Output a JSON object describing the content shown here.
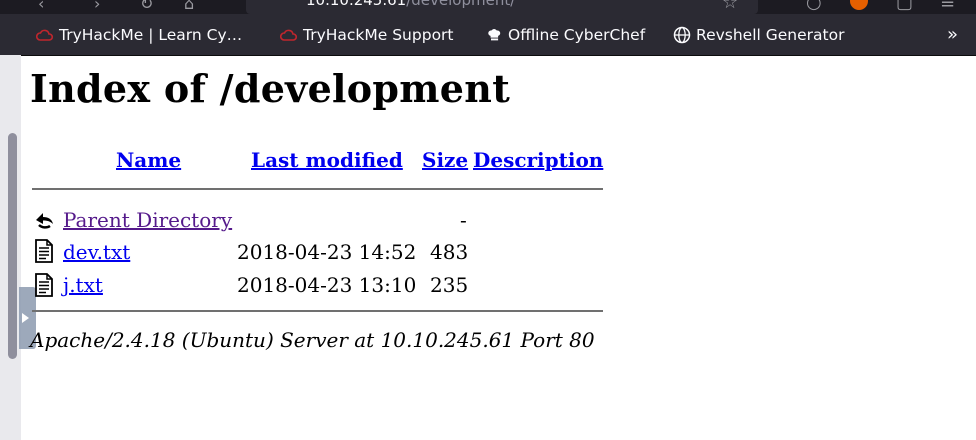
{
  "browser": {
    "url_host": "10.10.245.61",
    "url_path": "/development/",
    "bookmarks": [
      {
        "label": "TryHackMe | Learn Cy…",
        "icon": "tryhackme-cloud-icon"
      },
      {
        "label": "TryHackMe Support",
        "icon": "tryhackme-cloud-icon"
      },
      {
        "label": "Offline CyberChef",
        "icon": "chef-hat-icon"
      },
      {
        "label": "Revshell Generator",
        "icon": "globe-icon"
      }
    ],
    "overflow_label": "»",
    "colors": {
      "chrome_bg": "#2b2a33",
      "thm_icon": "#c0262d"
    }
  },
  "page": {
    "title": "Index of /development",
    "columns": {
      "name": "Name",
      "last_modified": "Last modified",
      "size": "Size",
      "description": "Description"
    },
    "entries": [
      {
        "name": "Parent Directory",
        "modified": "",
        "size": "-",
        "icon": "back-arrow-icon"
      },
      {
        "name": "dev.txt",
        "modified": "2018-04-23 14:52",
        "size": "483",
        "icon": "text-file-icon"
      },
      {
        "name": "j.txt",
        "modified": "2018-04-23 13:10",
        "size": "235",
        "icon": "text-file-icon"
      }
    ],
    "footer": "Apache/2.4.18 (Ubuntu) Server at 10.10.245.61 Port 80"
  }
}
